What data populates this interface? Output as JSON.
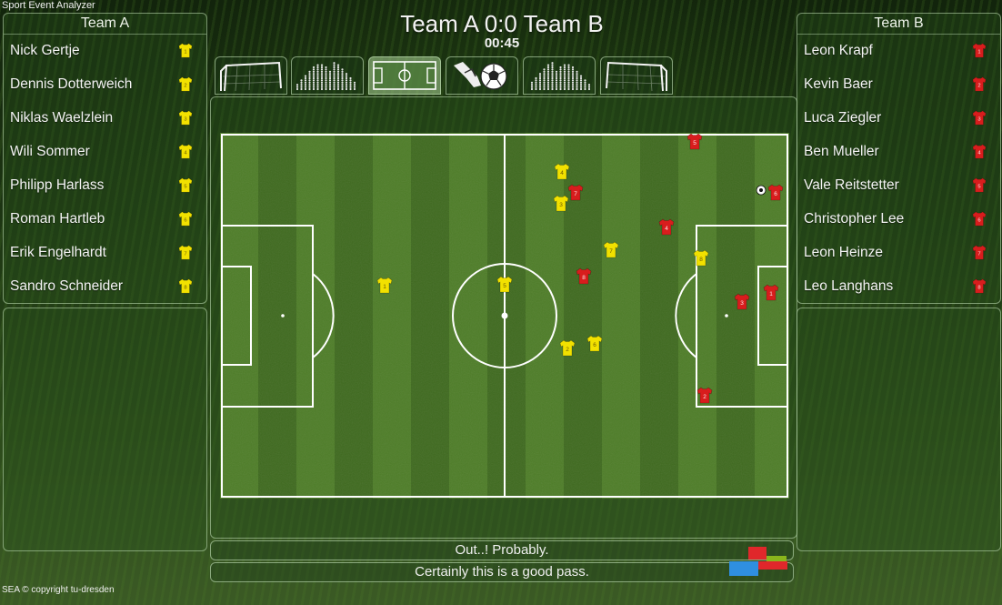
{
  "app_title": "Sport Event Analyzer",
  "copyright": "SEA © copyright tu-dresden",
  "scoreboard": {
    "score_text": "Team A 0:0 Team B",
    "clock": "00:45"
  },
  "tabs": [
    {
      "icon": "goal-left-icon",
      "active": false
    },
    {
      "icon": "crowd-left-icon",
      "active": false
    },
    {
      "icon": "field-icon",
      "active": true
    },
    {
      "icon": "kick-ball-icon",
      "active": false
    },
    {
      "icon": "crowd-right-icon",
      "active": false
    },
    {
      "icon": "goal-right-icon",
      "active": false
    }
  ],
  "team_a": {
    "name": "Team A",
    "shirt_color": "#f2e100",
    "players": [
      {
        "name": "Nick Gertje",
        "number": "1"
      },
      {
        "name": "Dennis Dotterweich",
        "number": "2"
      },
      {
        "name": "Niklas Waelzlein",
        "number": "3"
      },
      {
        "name": "Wili Sommer",
        "number": "4"
      },
      {
        "name": "Philipp Harlass",
        "number": "5"
      },
      {
        "name": "Roman Hartleb",
        "number": "6"
      },
      {
        "name": "Erik Engelhardt",
        "number": "7"
      },
      {
        "name": "Sandro Schneider",
        "number": "8"
      }
    ]
  },
  "team_b": {
    "name": "Team B",
    "shirt_color": "#d81d1d",
    "players": [
      {
        "name": "Leon Krapf",
        "number": "1"
      },
      {
        "name": "Kevin Baer",
        "number": "2"
      },
      {
        "name": "Luca Ziegler",
        "number": "3"
      },
      {
        "name": "Ben Mueller",
        "number": "4"
      },
      {
        "name": "Vale Reitstetter",
        "number": "5"
      },
      {
        "name": "Christopher Lee",
        "number": "6"
      },
      {
        "name": "Leon Heinze",
        "number": "7"
      },
      {
        "name": "Leo Langhans",
        "number": "8"
      }
    ]
  },
  "messages": [
    "Out..! Probably.",
    "Certainly this is a good pass."
  ],
  "legend_colors": [
    "#e0272b",
    "#8ab51c",
    "#2f8fe0",
    "#e0272b"
  ]
}
